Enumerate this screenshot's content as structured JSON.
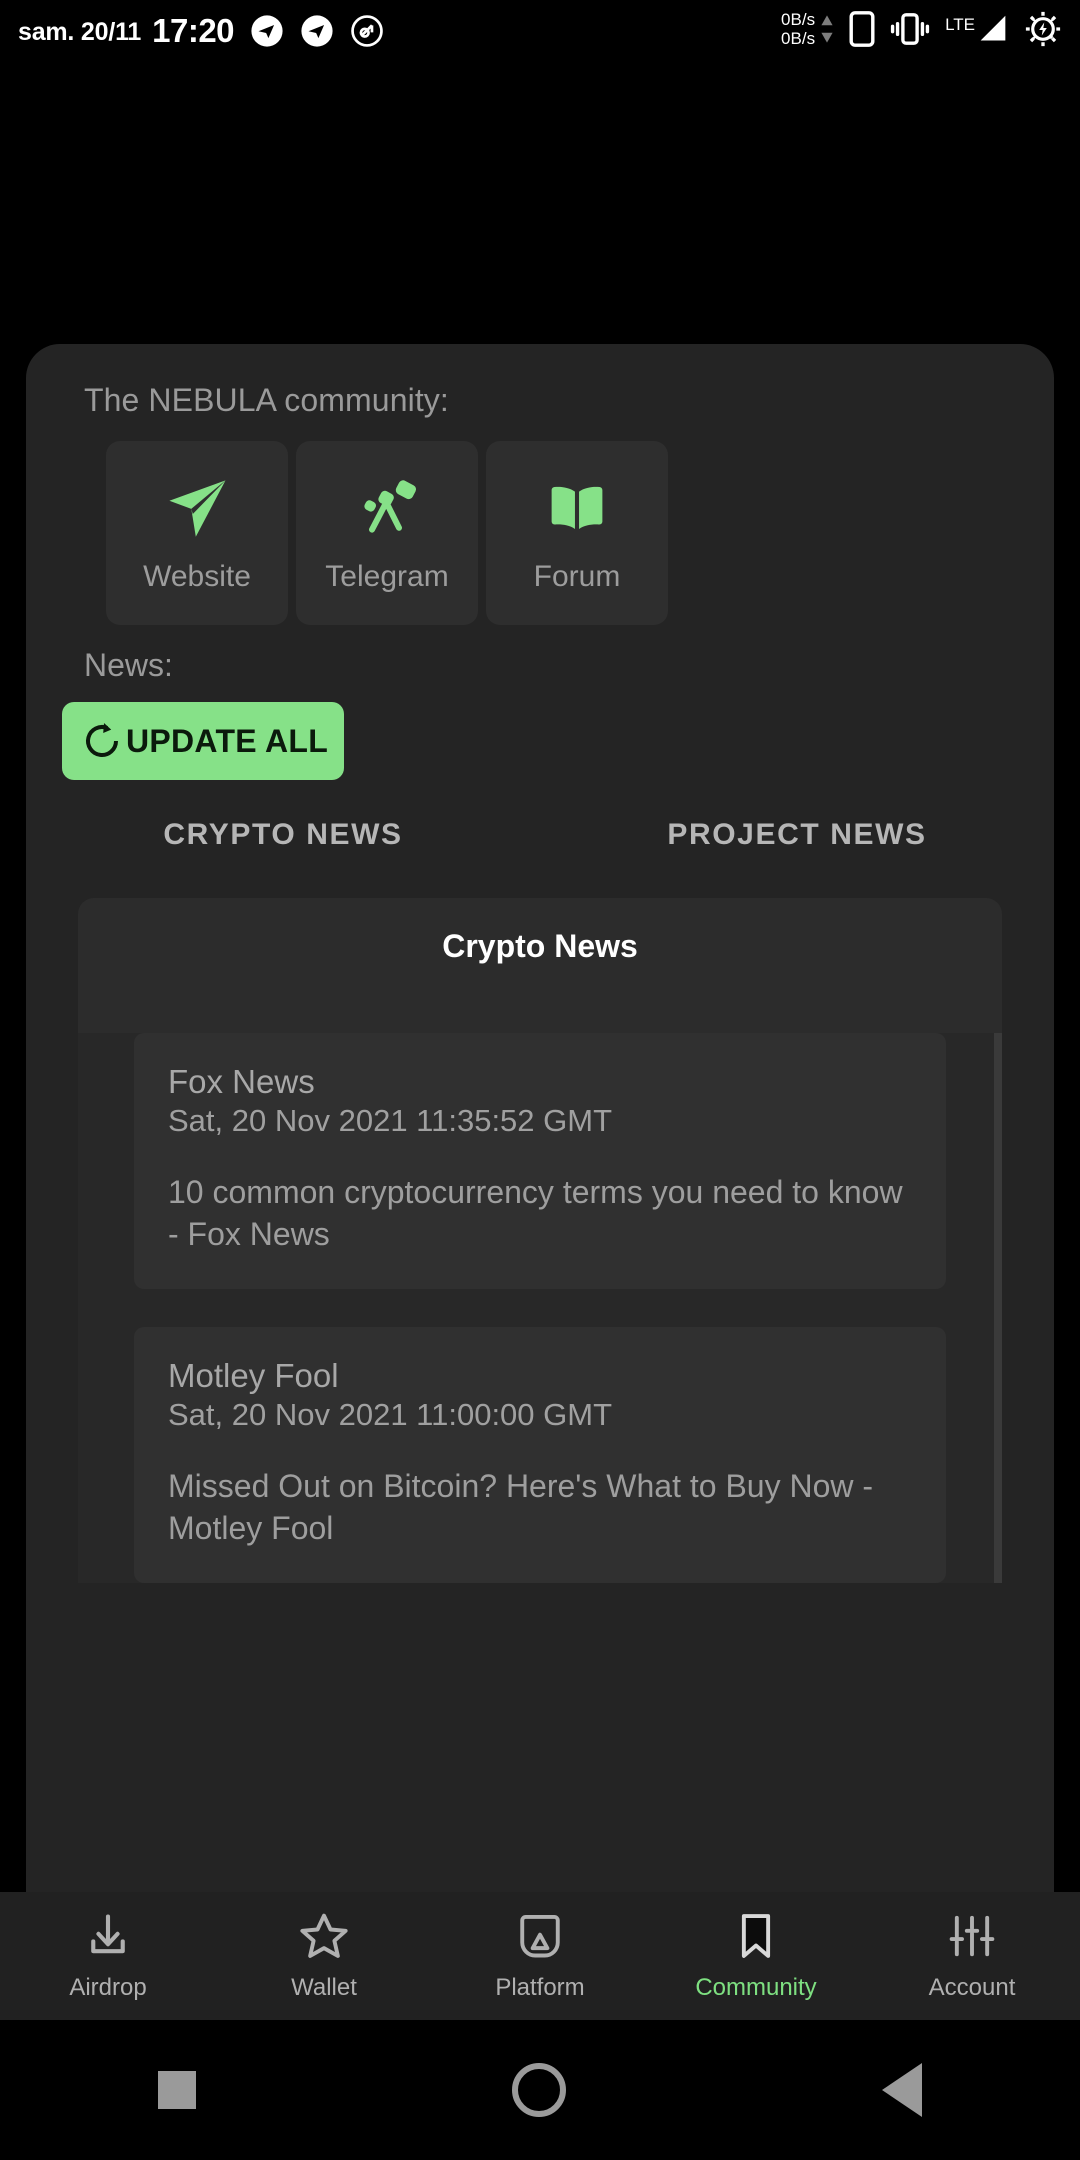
{
  "status_bar": {
    "date": "sam. 20/11",
    "time": "17:20",
    "left_icons": [
      "telegram-icon",
      "telegram-icon",
      "quick-action-icon"
    ],
    "net_speed_up": "0B/s",
    "net_speed_down": "0B/s",
    "right_icons": [
      "phone-icon",
      "vibrate-icon",
      "signal-icon",
      "battery-charging-icon"
    ],
    "network_type": "LTE"
  },
  "community": {
    "heading": "The NEBULA community:",
    "buttons": [
      {
        "label": "Website",
        "icon": "paper-plane-icon"
      },
      {
        "label": "Telegram",
        "icon": "telescope-icon"
      },
      {
        "label": "Forum",
        "icon": "open-book-icon"
      }
    ]
  },
  "news_section": {
    "heading": "News:",
    "update_button": {
      "label": "UPDATE ALL",
      "icon": "refresh-icon"
    },
    "tabs": [
      {
        "label": "CRYPTO NEWS",
        "active": true
      },
      {
        "label": "PROJECT NEWS",
        "active": false
      }
    ],
    "panel_title": "Crypto News",
    "articles": [
      {
        "source": "Fox News",
        "date": "Sat, 20 Nov 2021 11:35:52 GMT",
        "title": "10 common cryptocurrency terms you need to know - Fox News"
      },
      {
        "source": "Motley Fool",
        "date": "Sat, 20 Nov 2021 11:00:00 GMT",
        "title": "Missed Out on Bitcoin? Here's What to Buy Now - Motley Fool"
      }
    ]
  },
  "bottom_nav": {
    "items": [
      {
        "label": "Airdrop",
        "icon": "download-icon",
        "active": false
      },
      {
        "label": "Wallet",
        "icon": "star-icon",
        "active": false
      },
      {
        "label": "Platform",
        "icon": "cast-icon",
        "active": false
      },
      {
        "label": "Community",
        "icon": "bookmark-icon",
        "active": true
      },
      {
        "label": "Account",
        "icon": "sliders-icon",
        "active": false
      }
    ]
  },
  "android_nav": {
    "recent": "square-icon",
    "home": "circle-icon",
    "back": "triangle-back-icon"
  },
  "colors": {
    "accent_green": "#86e188",
    "card_bg": "#242424",
    "page_bg": "#000000",
    "muted_text": "#9a9a9a"
  }
}
